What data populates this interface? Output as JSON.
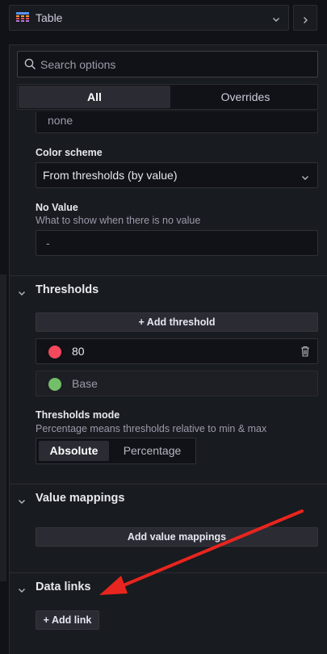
{
  "header": {
    "viz_name": "Table",
    "viz_icon": "table-icon"
  },
  "search": {
    "placeholder": "Search options"
  },
  "tabs": [
    {
      "label": "All"
    },
    {
      "label": "Overrides"
    }
  ],
  "standard": {
    "clipped_value": "none",
    "color_scheme": {
      "label": "Color scheme",
      "value": "From thresholds (by value)"
    },
    "no_value": {
      "label": "No Value",
      "description": "What to show when there is no value",
      "placeholder": "-"
    }
  },
  "thresholds": {
    "title": "Thresholds",
    "add_label": "Add threshold",
    "items": [
      {
        "value": "80",
        "color": "#f2495c"
      },
      {
        "value": "Base",
        "color": "#73bf69"
      }
    ],
    "mode": {
      "label": "Thresholds mode",
      "description": "Percentage means thresholds relative to min & max",
      "options": [
        "Absolute",
        "Percentage"
      ],
      "selected": "Absolute"
    }
  },
  "value_mappings": {
    "title": "Value mappings",
    "add_label": "Add value mappings"
  },
  "data_links": {
    "title": "Data links",
    "add_label": "Add link"
  },
  "annotation": {
    "arrow_color": "#e8251e"
  }
}
